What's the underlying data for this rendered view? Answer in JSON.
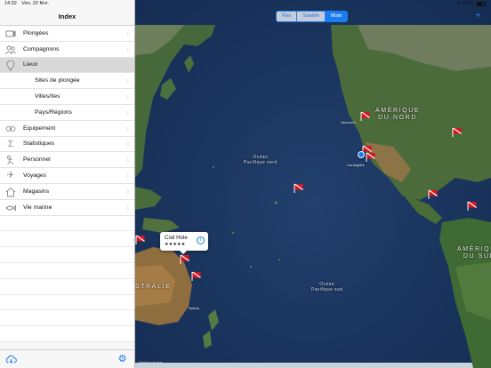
{
  "status": {
    "time": "14:32",
    "date": "Ven. 22 févr.",
    "battery": "60 %"
  },
  "sidebar": {
    "title": "Index",
    "items": [
      {
        "label": "Plongées",
        "icon": "camera-flag-icon",
        "sub": false,
        "selected": false
      },
      {
        "label": "Compagnons",
        "icon": "people-icon",
        "sub": false,
        "selected": false
      },
      {
        "label": "Lieux",
        "icon": "map-pin-icon",
        "sub": false,
        "selected": true
      },
      {
        "label": "Sites de plongée",
        "icon": "",
        "sub": true,
        "selected": false
      },
      {
        "label": "Villes/Iles",
        "icon": "",
        "sub": true,
        "selected": false
      },
      {
        "label": "Pays/Régions",
        "icon": "",
        "sub": true,
        "selected": false
      },
      {
        "label": "Equipement",
        "icon": "diving-mask-icon",
        "sub": false,
        "selected": false
      },
      {
        "label": "Statistiques",
        "icon": "sigma-icon",
        "sub": false,
        "selected": false
      },
      {
        "label": "Personnel",
        "icon": "diver-icon",
        "sub": false,
        "selected": false
      },
      {
        "label": "Voyages",
        "icon": "airplane-icon",
        "sub": false,
        "selected": false
      },
      {
        "label": "Magasins",
        "icon": "house-icon",
        "sub": false,
        "selected": false
      },
      {
        "label": "Vie marine",
        "icon": "fish-icon",
        "sub": false,
        "selected": false
      }
    ],
    "footer": {
      "sync_icon": "cloud-sync-icon",
      "settings_icon": "gear-icon"
    }
  },
  "map": {
    "segments": [
      {
        "label": "Plan",
        "active": false
      },
      {
        "label": "Satellite",
        "active": false
      },
      {
        "label": "Mixte",
        "active": true
      }
    ],
    "labels": {
      "north_america": "AMÉRIQUE\nDU NORD",
      "south_america": "AMÉRIQUE\nDU SUD",
      "australia": "STRALIE",
      "ocean_north": "Océan\nPacifique nord",
      "ocean_south": "Océan\nPacifique sud",
      "city_la": "Los Angeles",
      "city_sydney": "Sydney",
      "city_vancouver": "Vancouver"
    },
    "callout": {
      "title": "Cod Hole",
      "rating": "★★★★★"
    },
    "legal": "Mentions légales",
    "flag_color": "#d8141e",
    "accent_color": "#1a7cf0"
  }
}
